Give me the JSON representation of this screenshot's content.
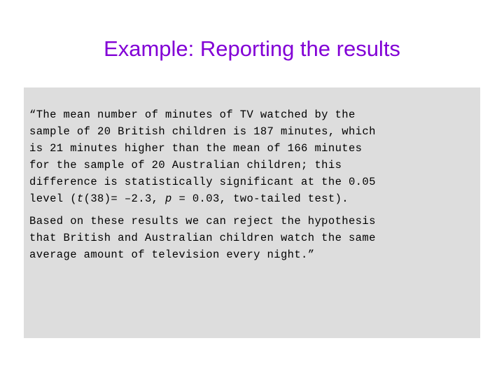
{
  "slide": {
    "title": "Example: Reporting the results",
    "title_color": "#8200d6",
    "content_box_color": "#dddddd",
    "background_color": "#ffffff"
  },
  "quote": {
    "paragraph1": {
      "part1": "“The mean number of minutes of TV watched by the\nsample of 20 British children is 187 minutes, which\nis 21 minutes higher than the mean of 166 minutes\nfor the sample of 20 Australian children; this\ndifference is statistically significant at the 0.05\nlevel (",
      "t_symbol": "t",
      "part2": "(38)= –2.3, ",
      "p_symbol": "p",
      "part3": " = 0.03, two-tailed test)."
    },
    "paragraph2": "Based on these results we can reject the hypothesis\nthat British and Australian children watch the same\naverage amount of television every night.”"
  }
}
